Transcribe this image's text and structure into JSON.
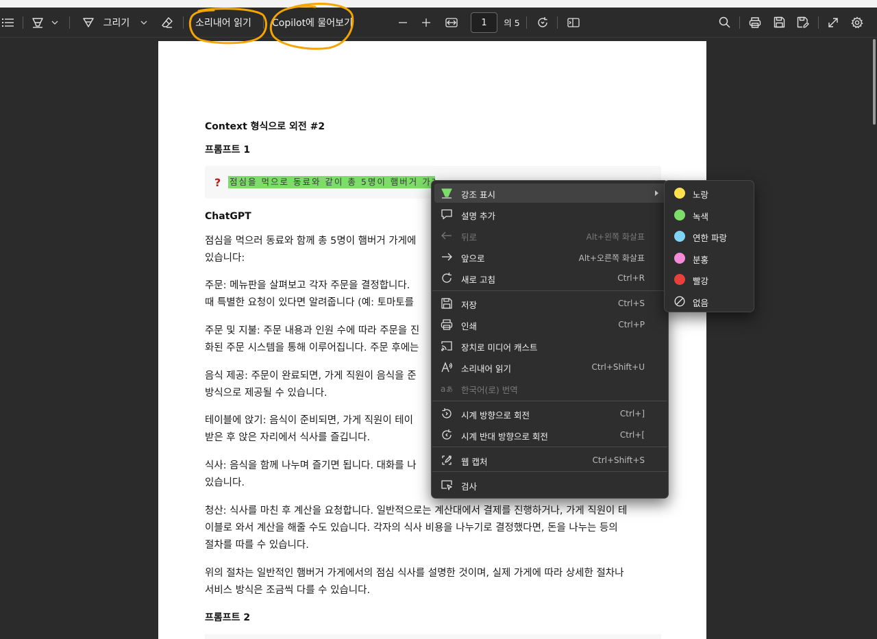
{
  "toolbar": {
    "contents_icon": "list-icon",
    "highlight_icon": "highlighter-icon",
    "draw_label": "그리기",
    "eraser_icon": "eraser-icon",
    "read_aloud_label": "소리내어 읽기",
    "copilot_label": "Copilot에 물어보기",
    "zoom_out_icon": "minus-icon",
    "zoom_in_icon": "plus-icon",
    "fit_icon": "fit-width-icon",
    "page_number": "1",
    "page_total": "의 5",
    "rotate_icon": "rotate-icon",
    "page_view_icon": "page-view-icon",
    "search_icon": "search-icon",
    "print_icon": "print-icon",
    "save_icon": "save-icon",
    "save_as_icon": "save-as-icon",
    "fullscreen_icon": "fullscreen-icon",
    "settings_icon": "gear-icon",
    "annotation_color": "#f5a400"
  },
  "document": {
    "title": "Context 형식으로 외전 #2",
    "prompt1_heading": "프롬프트 1",
    "prompt1_text": "점심을 먹으로 동료와 같이 총 5명이 햄버거 가게에 가서",
    "highlight_color": "#7ddc6a",
    "chatgpt_heading": "ChatGPT",
    "paragraphs": [
      "점심을 먹으러 동료와 함께 총 5명이 햄버거 가게에\n있습니다:",
      "주문: 메뉴판을 살펴보고 각자 주문을 결정합니다.\n때 특별한 요청이 있다면 알려줍니다 (예: 토마토를",
      "주문 및 지불: 주문 내용과 인원 수에 따라 주문을 진\n화된 주문 시스템을 통해 이루어집니다. 주문 후에는",
      "음식 제공: 주문이 완료되면, 가게 직원이 음식을 준\n방식으로 제공될 수 있습니다.",
      "테이블에 앉기: 음식이 준비되면, 가게 직원이 테이\n받은 후 앉은 자리에서 식사를 즐깁니다.",
      "식사: 음식을 함께 나누며 즐기면 됩니다. 대화를 나\n있습니다.",
      "청산: 식사를 마친 후 계산을 요청합니다. 일반적으로는 계산대에서 결제를 진행하거나, 가게 직원이 테\n이블로 와서 계산을 해줄 수도 있습니다. 각자의 식사 비용을 나누기로 결정했다면, 돈을 나누는 등의\n절차를 따를 수 있습니다.",
      "위의 절차는 일반적인 햄버거 가게에서의 점심 식사를 설명한 것이며, 실제 가게에 따라 상세한 절차나\n서비스 방식은 조금씩 다를 수 있습니다."
    ],
    "prompt2_heading": "프롬프트 2"
  },
  "context_menu": {
    "items": [
      {
        "label": "강조 표시",
        "shortcut": "",
        "icon": "highlighter-icon",
        "disabled": false,
        "active": true,
        "submenu": true
      },
      {
        "label": "설명 추가",
        "shortcut": "",
        "icon": "comment-icon",
        "disabled": false
      },
      {
        "label": "뒤로",
        "shortcut": "Alt+왼쪽 화살표",
        "icon": "arrow-left-icon",
        "disabled": true
      },
      {
        "label": "앞으로",
        "shortcut": "Alt+오른쪽 화살표",
        "icon": "arrow-right-icon",
        "disabled": false
      },
      {
        "label": "새로 고침",
        "shortcut": "Ctrl+R",
        "icon": "refresh-icon",
        "disabled": false
      },
      {
        "label": "저장",
        "shortcut": "Ctrl+S",
        "icon": "save-icon",
        "disabled": false
      },
      {
        "label": "인쇄",
        "shortcut": "Ctrl+P",
        "icon": "print-icon",
        "disabled": false
      },
      {
        "label": "장치로 미디어 캐스트",
        "shortcut": "",
        "icon": "cast-icon",
        "disabled": false
      },
      {
        "label": "소리내어 읽기",
        "shortcut": "Ctrl+Shift+U",
        "icon": "read-aloud-icon",
        "disabled": false
      },
      {
        "label": "한국어(로) 번역",
        "shortcut": "",
        "icon": "translate-icon",
        "disabled": true
      },
      {
        "label": "시계 방향으로 회전",
        "shortcut": "Ctrl+]",
        "icon": "rotate-cw-icon",
        "disabled": false
      },
      {
        "label": "시계 반대 방향으로 회전",
        "shortcut": "Ctrl+[",
        "icon": "rotate-ccw-icon",
        "disabled": false
      },
      {
        "label": "웹 캡처",
        "shortcut": "Ctrl+Shift+S",
        "icon": "web-capture-icon",
        "disabled": false
      },
      {
        "label": "검사",
        "shortcut": "",
        "icon": "inspect-icon",
        "disabled": false
      }
    ]
  },
  "highlight_submenu": {
    "items": [
      {
        "label": "노랑",
        "color": "#ffe14d"
      },
      {
        "label": "녹색",
        "color": "#7ddc6a"
      },
      {
        "label": "연한 파랑",
        "color": "#7fd4f5"
      },
      {
        "label": "분홍",
        "color": "#f58ad8"
      },
      {
        "label": "빨강",
        "color": "#e8413c"
      },
      {
        "label": "없음",
        "color": "none"
      }
    ]
  }
}
